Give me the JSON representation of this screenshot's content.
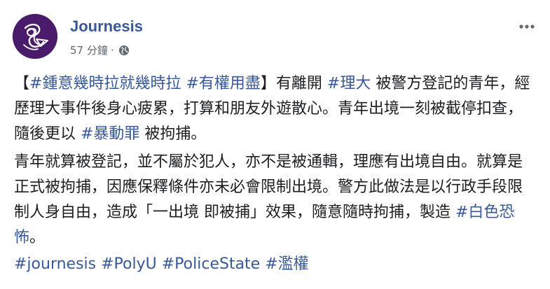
{
  "post": {
    "page_name": "Journesis",
    "timestamp": "57 分鐘",
    "separator": "·",
    "privacy_icon": "globe-icon",
    "more_icon": "ellipsis-icon",
    "paragraph1": {
      "open_bracket": "【",
      "tag1": "#鍾意幾時拉就幾時拉",
      "space1": " ",
      "tag2": "#有權用盡",
      "close_text": "】有離開 ",
      "tag3": "#理大",
      "text2": " 被警方登記的青年，經歷理大事件後身心疲累，打算和朋友外遊散心。青年出境一刻被截停扣查，隨後更以 ",
      "tag4": "#暴動罪",
      "text3": " 被拘捕。"
    },
    "paragraph2": {
      "text1": "青年就算被登記，並不屬於犯人，亦不是被通輯，理應有出境自由。就算是正式被拘捕，因應保釋條件亦未必會限制出境。警方此做法是以行政手段限制人身自由，造成「一出境 即被捕」效果，隨意隨時拘捕，製造 ",
      "tag1": "#白色恐怖",
      "text2": "。"
    },
    "hashtags": [
      "#journesis",
      "#PolyU",
      "#PoliceState",
      "#濫權"
    ]
  },
  "colors": {
    "link": "#385898",
    "text": "#1c1e21",
    "meta": "#616770",
    "avatar_bg": "#4a1a6b"
  }
}
